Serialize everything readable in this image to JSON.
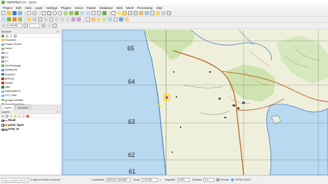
{
  "window": {
    "title": "*ศสร์ทรัพยากร - QGIS"
  },
  "menu": [
    "Project",
    "Edit",
    "View",
    "Layer",
    "Settings",
    "Plugins",
    "Vector",
    "Raster",
    "Database",
    "Web",
    "Mesh",
    "Processing",
    "Help"
  ],
  "scale_field": "1:50,000",
  "browser": {
    "title": "Browser",
    "items": [
      {
        "label": "Favorites",
        "icon_color": "#f2c744"
      },
      {
        "label": "Project Home",
        "icon_color": "#6fa8dc"
      },
      {
        "label": "Home",
        "icon_color": "#c49a5a"
      },
      {
        "label": "C:\\",
        "icon_color": "#9e9e9e"
      },
      {
        "label": "D:\\",
        "icon_color": "#9e9e9e"
      },
      {
        "label": "E:\\",
        "icon_color": "#9e9e9e"
      },
      {
        "label": "GeoPackage",
        "icon_color": "#76b544"
      },
      {
        "label": "SpatiaLite",
        "icon_color": "#4a8fd4"
      },
      {
        "label": "PostGIS",
        "icon_color": "#336791"
      },
      {
        "label": "MSSQL",
        "icon_color": "#b23a2f"
      },
      {
        "label": "Oracle",
        "icon_color": "#d32f2f"
      },
      {
        "label": "DB2",
        "icon_color": "#2e7d32"
      },
      {
        "label": "WMS/WMTS",
        "icon_color": "#64b5f6"
      },
      {
        "label": "XYZ Tiles",
        "icon_color": "#64b5f6"
      },
      {
        "label": "google satellite",
        "icon_color": "#8bc34a"
      },
      {
        "label": "OpenStreetMap",
        "icon_color": "#8bc34a"
      }
    ]
  },
  "panel_tabs": [
    "Layers",
    "Browser"
  ],
  "layers": {
    "title": "Layers",
    "items": [
      {
        "label": "Road",
        "symbol_color": "#d9534f"
      },
      {
        "label": "point_layer",
        "symbol_color": "#f0ad4e"
      },
      {
        "label": "5733_IV",
        "symbol_color": "#7b7b7b"
      }
    ]
  },
  "map": {
    "grid_labels": [
      "65",
      "64",
      "63",
      "62",
      "61"
    ],
    "coast_color": "#3a6fb0",
    "sea_color": "#b9d9f0",
    "land_color": "#eef0dc",
    "forest_color": "#cfe3b0"
  },
  "status": {
    "search_placeholder": "Type to locate (Ctrl+K)",
    "message": "2 legend entries removed.",
    "coordinate_label": "Coordinate",
    "coordinate_value": "1567032,1461568",
    "scale_label": "Scale",
    "scale_value": "1:30,000",
    "magnifier_label": "Magnifier",
    "magnifier_value": "100%",
    "rotation_label": "Rotation",
    "rotation_value": "0.0 °",
    "render_label": "Render",
    "crs_label": "EPSG:24047"
  }
}
